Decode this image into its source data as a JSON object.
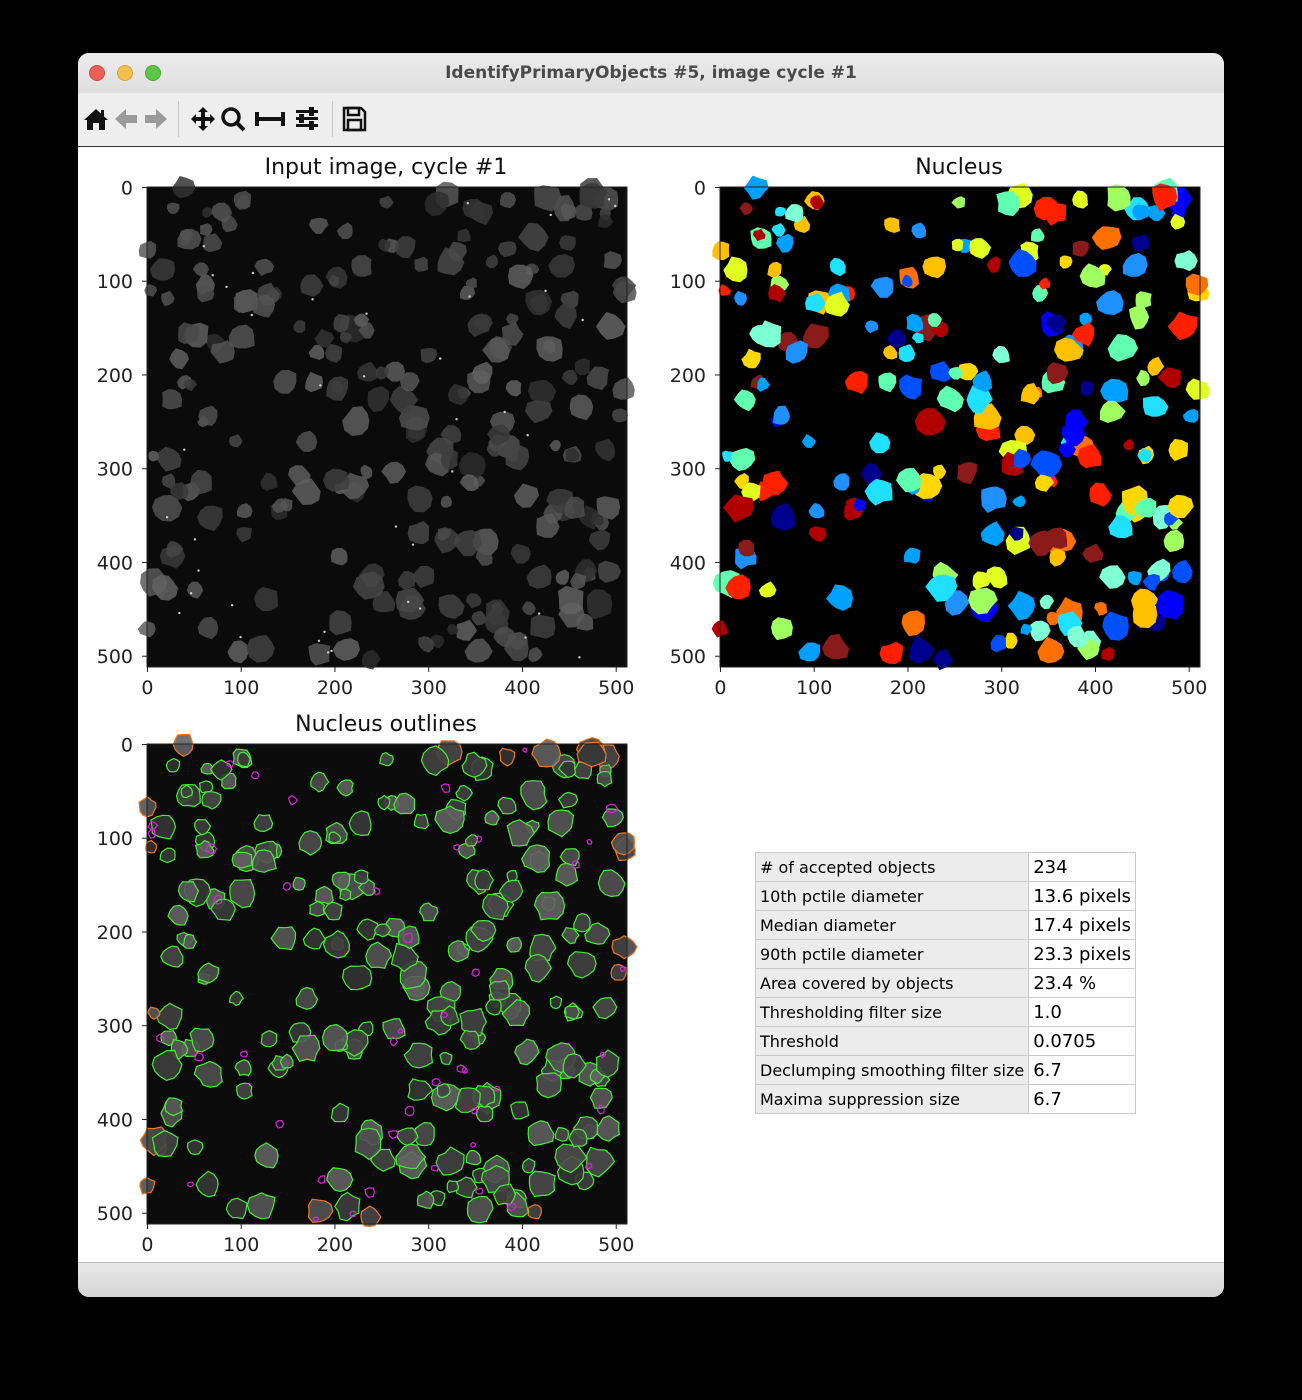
{
  "window": {
    "title": "IdentifyPrimaryObjects #5, image cycle #1"
  },
  "toolbar": {
    "buttons": [
      {
        "name": "home",
        "icon": "home-icon"
      },
      {
        "name": "back",
        "icon": "back-arrow-icon"
      },
      {
        "name": "forward",
        "icon": "forward-arrow-icon"
      },
      {
        "name": "pan",
        "icon": "pan-icon"
      },
      {
        "name": "zoom",
        "icon": "zoom-icon"
      },
      {
        "name": "subplots",
        "icon": "subplots-icon"
      },
      {
        "name": "customize",
        "icon": "sliders-icon"
      },
      {
        "name": "save",
        "icon": "save-icon"
      }
    ]
  },
  "plots": {
    "input": {
      "title": "Input image, cycle #1",
      "xticks": [
        "0",
        "100",
        "200",
        "300",
        "400",
        "500"
      ],
      "yticks": [
        "0",
        "100",
        "200",
        "300",
        "400",
        "500"
      ]
    },
    "nucleus": {
      "title": "Nucleus",
      "xticks": [
        "0",
        "100",
        "200",
        "300",
        "400",
        "500"
      ],
      "yticks": [
        "0",
        "100",
        "200",
        "300",
        "400",
        "500"
      ]
    },
    "outlines": {
      "title": "Nucleus outlines",
      "xticks": [
        "0",
        "100",
        "200",
        "300",
        "400",
        "500"
      ],
      "yticks": [
        "0",
        "100",
        "200",
        "300",
        "400",
        "500"
      ]
    }
  },
  "metrics": [
    {
      "label": "# of accepted objects",
      "value": "234"
    },
    {
      "label": "10th pctile diameter",
      "value": "13.6 pixels"
    },
    {
      "label": "Median diameter",
      "value": "17.4 pixels"
    },
    {
      "label": "90th pctile diameter",
      "value": "23.3 pixels"
    },
    {
      "label": "Area covered by objects",
      "value": "23.4 %"
    },
    {
      "label": "Thresholding filter size",
      "value": "1.0"
    },
    {
      "label": "Threshold",
      "value": "0.0705"
    },
    {
      "label": "Declumping smoothing filter size",
      "value": "6.7"
    },
    {
      "label": "Maxima suppression size",
      "value": "6.7"
    }
  ],
  "colors": {
    "window_bg": "#ffffff",
    "titlebar": "#e4e4e4",
    "image_bg": "#000000",
    "outline_accepted": "#44ee33",
    "outline_border": "#ee7722",
    "outline_filtered": "#dd22dd"
  }
}
